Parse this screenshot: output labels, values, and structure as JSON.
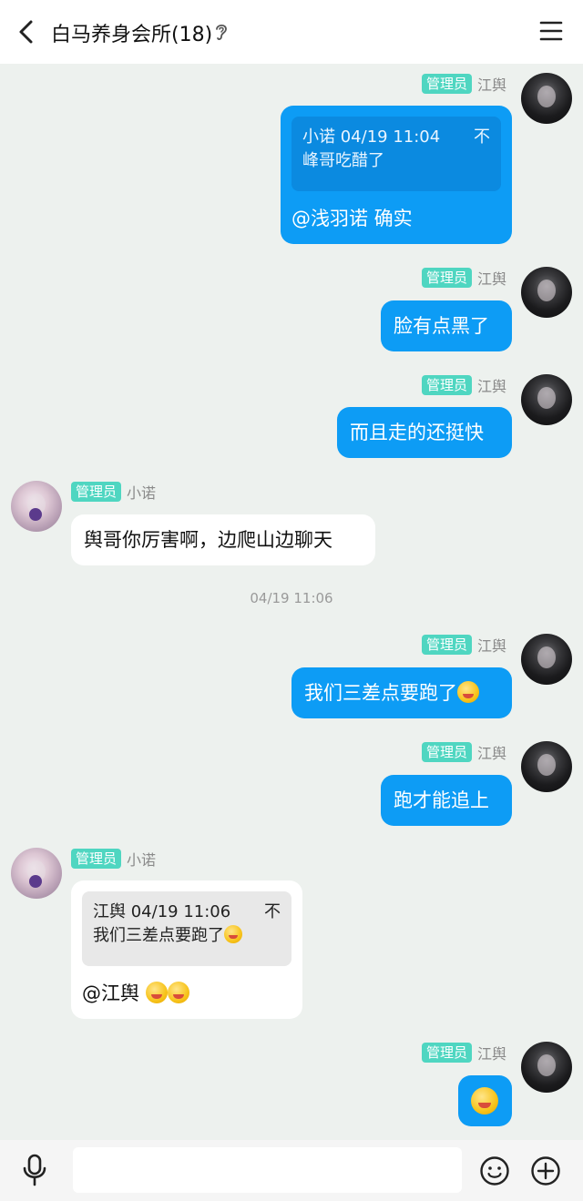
{
  "header": {
    "title": "白马养身会所(18)",
    "back_icon": "chevron-left-icon",
    "mute_icon": "ear-icon",
    "menu_icon": "hamburger-menu-icon"
  },
  "messages": [
    {
      "sender": "江舆",
      "role": "管理员",
      "direction": "out",
      "quote": {
        "author_time": "小诺 04/19 11:04",
        "text": "峰哥吃醋了"
      },
      "text": "@浅羽诺 确实"
    },
    {
      "sender": "江舆",
      "role": "管理员",
      "direction": "out",
      "text": "脸有点黑了"
    },
    {
      "sender": "江舆",
      "role": "管理员",
      "direction": "out",
      "text": "而且走的还挺快"
    },
    {
      "sender": "小诺",
      "role": "管理员",
      "direction": "in",
      "text": "舆哥你厉害啊，边爬山边聊天"
    },
    {
      "sender": "江舆",
      "role": "管理员",
      "direction": "out",
      "text": "我们三差点要跑了",
      "emoji": "laughing-tongue-emoji"
    },
    {
      "sender": "江舆",
      "role": "管理员",
      "direction": "out",
      "text": "跑才能追上"
    },
    {
      "sender": "小诺",
      "role": "管理员",
      "direction": "in",
      "quote": {
        "author_time": "江舆 04/19 11:06",
        "text": "我们三差点要跑了"
      },
      "text": "@江舆 "
    },
    {
      "sender": "江舆",
      "role": "管理员",
      "direction": "out",
      "emoji_only": "laughing-tongue-emoji"
    }
  ],
  "timestamp": "04/19 11:06",
  "quote_arrow": "不",
  "colors": {
    "outgoing_bubble": "#0d9cf5",
    "incoming_bubble": "#ffffff",
    "admin_badge": "#4fd6c1",
    "background": "#edf1ee"
  },
  "input": {
    "placeholder": "",
    "value": ""
  },
  "bottom_icons": [
    "microphone-icon",
    "smiley-icon",
    "plus-circle-icon"
  ]
}
